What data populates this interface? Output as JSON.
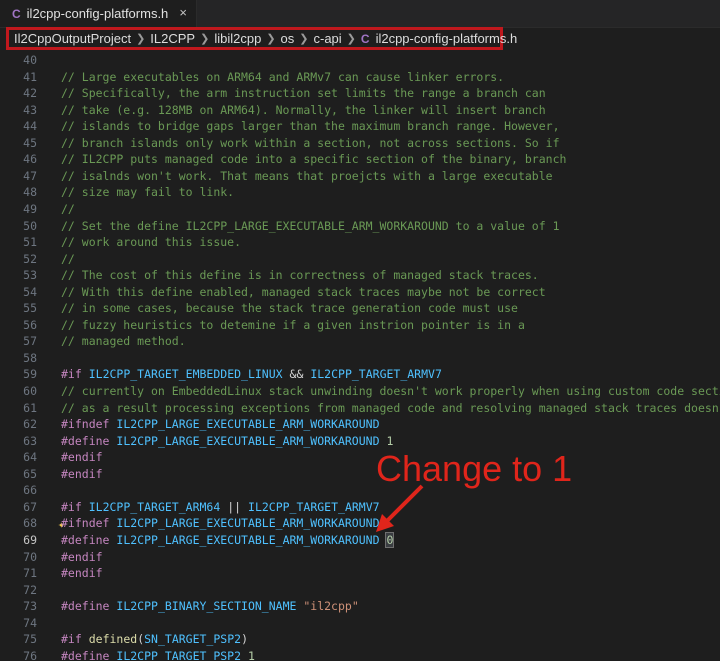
{
  "tab": {
    "icon": "C",
    "title": "il2cpp-config-platforms.h",
    "close": "×"
  },
  "breadcrumbs": [
    "Il2CppOutputProject",
    "IL2CPP",
    "libil2cpp",
    "os",
    "c-api"
  ],
  "breadcrumb_file": {
    "icon": "C",
    "name": "il2cpp-config-platforms.h"
  },
  "annotation": "Change to 1",
  "colors": {
    "annotation": "#e0251b",
    "highlight_border": "#c0181d"
  },
  "active_line": 69,
  "lines": [
    {
      "n": 40,
      "tokens": []
    },
    {
      "n": 41,
      "tokens": [
        [
          "comment",
          "// Large executables on ARM64 and ARMv7 can cause linker errors."
        ]
      ]
    },
    {
      "n": 42,
      "tokens": [
        [
          "comment",
          "// Specifically, the arm instruction set limits the range a branch can"
        ]
      ]
    },
    {
      "n": 43,
      "tokens": [
        [
          "comment",
          "// take (e.g. 128MB on ARM64). Normally, the linker will insert branch"
        ]
      ]
    },
    {
      "n": 44,
      "tokens": [
        [
          "comment",
          "// islands to bridge gaps larger than the maximum branch range. However,"
        ]
      ]
    },
    {
      "n": 45,
      "tokens": [
        [
          "comment",
          "// branch islands only work within a section, not across sections. So if"
        ]
      ]
    },
    {
      "n": 46,
      "tokens": [
        [
          "comment",
          "// IL2CPP puts managed code into a specific section of the binary, branch"
        ]
      ]
    },
    {
      "n": 47,
      "tokens": [
        [
          "comment",
          "// isalnds won't work. That means that proejcts with a large executable"
        ]
      ]
    },
    {
      "n": 48,
      "tokens": [
        [
          "comment",
          "// size may fail to link."
        ]
      ]
    },
    {
      "n": 49,
      "tokens": [
        [
          "comment",
          "//"
        ]
      ]
    },
    {
      "n": 50,
      "tokens": [
        [
          "comment",
          "// Set the define IL2CPP_LARGE_EXECUTABLE_ARM_WORKAROUND to a value of 1"
        ]
      ]
    },
    {
      "n": 51,
      "tokens": [
        [
          "comment",
          "// work around this issue."
        ]
      ]
    },
    {
      "n": 52,
      "tokens": [
        [
          "comment",
          "//"
        ]
      ]
    },
    {
      "n": 53,
      "tokens": [
        [
          "comment",
          "// The cost of this define is in correctness of managed stack traces."
        ]
      ]
    },
    {
      "n": 54,
      "tokens": [
        [
          "comment",
          "// With this define enabled, managed stack traces maybe not be correct"
        ]
      ]
    },
    {
      "n": 55,
      "tokens": [
        [
          "comment",
          "// in some cases, because the stack trace generation code must use"
        ]
      ]
    },
    {
      "n": 56,
      "tokens": [
        [
          "comment",
          "// fuzzy heuristics to detemine if a given instrion pointer is in a"
        ]
      ]
    },
    {
      "n": 57,
      "tokens": [
        [
          "comment",
          "// managed method."
        ]
      ]
    },
    {
      "n": 58,
      "tokens": []
    },
    {
      "n": 59,
      "tokens": [
        [
          "kw",
          "#if"
        ],
        [
          "plain",
          " "
        ],
        [
          "macro",
          "IL2CPP_TARGET_EMBEDDED_LINUX"
        ],
        [
          "plain",
          " "
        ],
        [
          "op",
          "&&"
        ],
        [
          "plain",
          " "
        ],
        [
          "macro",
          "IL2CPP_TARGET_ARMV7"
        ]
      ]
    },
    {
      "n": 60,
      "tokens": [
        [
          "comment",
          "// currently on EmbeddedLinux stack unwinding doesn't work properly when using custom code sections"
        ]
      ]
    },
    {
      "n": 61,
      "tokens": [
        [
          "comment",
          "// as a result processing exceptions from managed code and resolving managed stack traces doesn't wo"
        ]
      ]
    },
    {
      "n": 62,
      "tokens": [
        [
          "kw",
          "#ifndef"
        ],
        [
          "plain",
          " "
        ],
        [
          "macro",
          "IL2CPP_LARGE_EXECUTABLE_ARM_WORKAROUND"
        ]
      ]
    },
    {
      "n": 63,
      "tokens": [
        [
          "kw",
          "#define"
        ],
        [
          "plain",
          " "
        ],
        [
          "macro",
          "IL2CPP_LARGE_EXECUTABLE_ARM_WORKAROUND"
        ],
        [
          "plain",
          " "
        ],
        [
          "num",
          "1"
        ]
      ]
    },
    {
      "n": 64,
      "tokens": [
        [
          "kw",
          "#endif"
        ]
      ]
    },
    {
      "n": 65,
      "tokens": [
        [
          "kw",
          "#endif"
        ]
      ]
    },
    {
      "n": 66,
      "tokens": []
    },
    {
      "n": 67,
      "tokens": [
        [
          "kw",
          "#if"
        ],
        [
          "plain",
          " "
        ],
        [
          "macro",
          "IL2CPP_TARGET_ARM64"
        ],
        [
          "plain",
          " "
        ],
        [
          "op",
          "||"
        ],
        [
          "plain",
          " "
        ],
        [
          "macro",
          "IL2CPP_TARGET_ARMV7"
        ]
      ]
    },
    {
      "n": 68,
      "tokens": [
        [
          "kw",
          "#ifndef"
        ],
        [
          "plain",
          " "
        ],
        [
          "macro",
          "IL2CPP_LARGE_EXECUTABLE_ARM_WORKAROUND"
        ]
      ],
      "sparkle": "✦"
    },
    {
      "n": 69,
      "tokens": [
        [
          "kw",
          "#define"
        ],
        [
          "plain",
          " "
        ],
        [
          "macro",
          "IL2CPP_LARGE_EXECUTABLE_ARM_WORKAROUND"
        ],
        [
          "plain",
          " "
        ],
        [
          "numcursor",
          "0"
        ]
      ]
    },
    {
      "n": 70,
      "tokens": [
        [
          "kw",
          "#endif"
        ]
      ]
    },
    {
      "n": 71,
      "tokens": [
        [
          "kw",
          "#endif"
        ]
      ]
    },
    {
      "n": 72,
      "tokens": []
    },
    {
      "n": 73,
      "tokens": [
        [
          "kw",
          "#define"
        ],
        [
          "plain",
          " "
        ],
        [
          "macro",
          "IL2CPP_BINARY_SECTION_NAME"
        ],
        [
          "plain",
          " "
        ],
        [
          "str",
          "\"il2cpp\""
        ]
      ]
    },
    {
      "n": 74,
      "tokens": []
    },
    {
      "n": 75,
      "tokens": [
        [
          "kw",
          "#if"
        ],
        [
          "plain",
          " "
        ],
        [
          "fn",
          "defined"
        ],
        [
          "plain",
          "("
        ],
        [
          "macro",
          "SN_TARGET_PSP2"
        ],
        [
          "plain",
          ")"
        ]
      ]
    },
    {
      "n": 76,
      "tokens": [
        [
          "kw",
          "#define"
        ],
        [
          "plain",
          " "
        ],
        [
          "macro",
          "IL2CPP_TARGET_PSP2"
        ],
        [
          "plain",
          " "
        ],
        [
          "num",
          "1"
        ]
      ]
    }
  ]
}
